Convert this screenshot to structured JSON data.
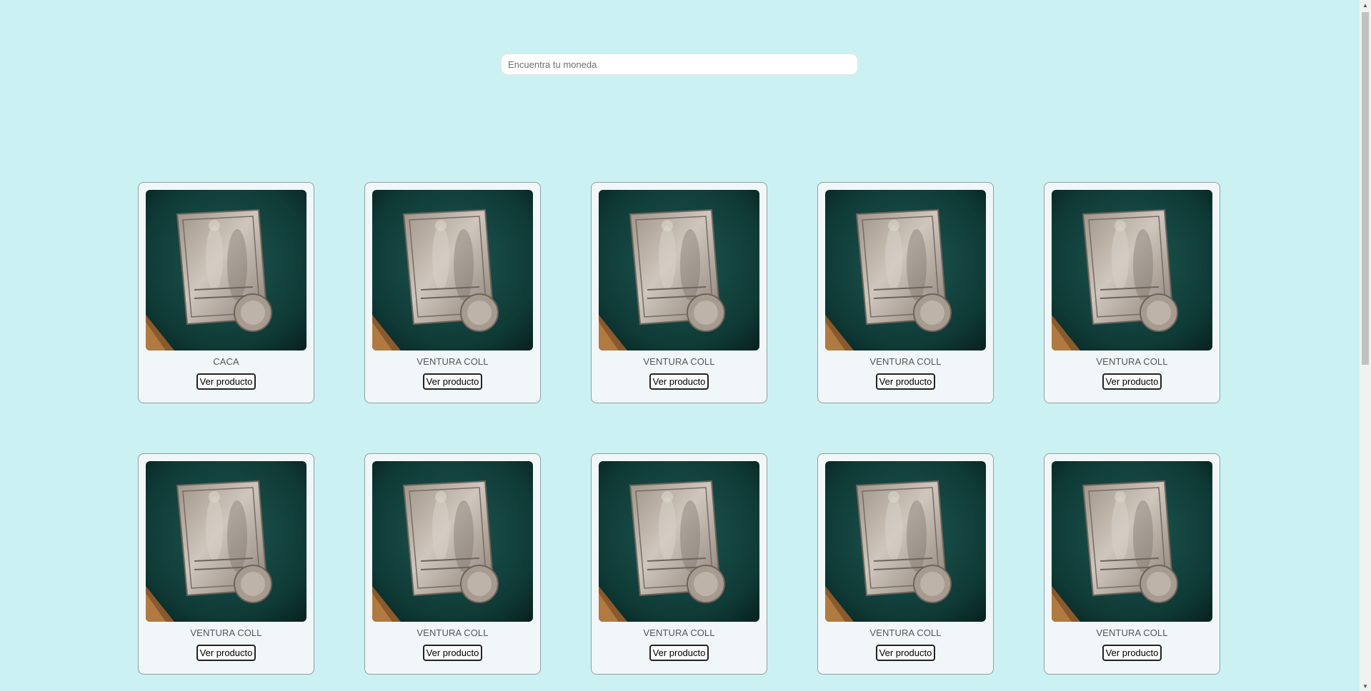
{
  "search": {
    "placeholder": "Encuentra tu moneda",
    "value": ""
  },
  "products": [
    {
      "title": "CACA",
      "button_label": "Ver producto"
    },
    {
      "title": "VENTURA COLL",
      "button_label": "Ver producto"
    },
    {
      "title": "VENTURA COLL",
      "button_label": "Ver producto"
    },
    {
      "title": "VENTURA COLL",
      "button_label": "Ver producto"
    },
    {
      "title": "VENTURA COLL",
      "button_label": "Ver producto"
    },
    {
      "title": "VENTURA COLL",
      "button_label": "Ver producto"
    },
    {
      "title": "VENTURA COLL",
      "button_label": "Ver producto"
    },
    {
      "title": "VENTURA COLL",
      "button_label": "Ver producto"
    },
    {
      "title": "VENTURA COLL",
      "button_label": "Ver producto"
    },
    {
      "title": "VENTURA COLL",
      "button_label": "Ver producto"
    }
  ],
  "colors": {
    "page_background": "#ccf1f2",
    "card_background": "#f1f7f8",
    "card_border": "#8f9fa3",
    "photo_background": "#0f3a36",
    "medal_silver": "#b7ada4"
  },
  "icons": {
    "product_image": "silver-medal-photo",
    "scroll_up": "scroll-up-arrow-icon",
    "scroll_down": "scroll-down-arrow-icon"
  }
}
